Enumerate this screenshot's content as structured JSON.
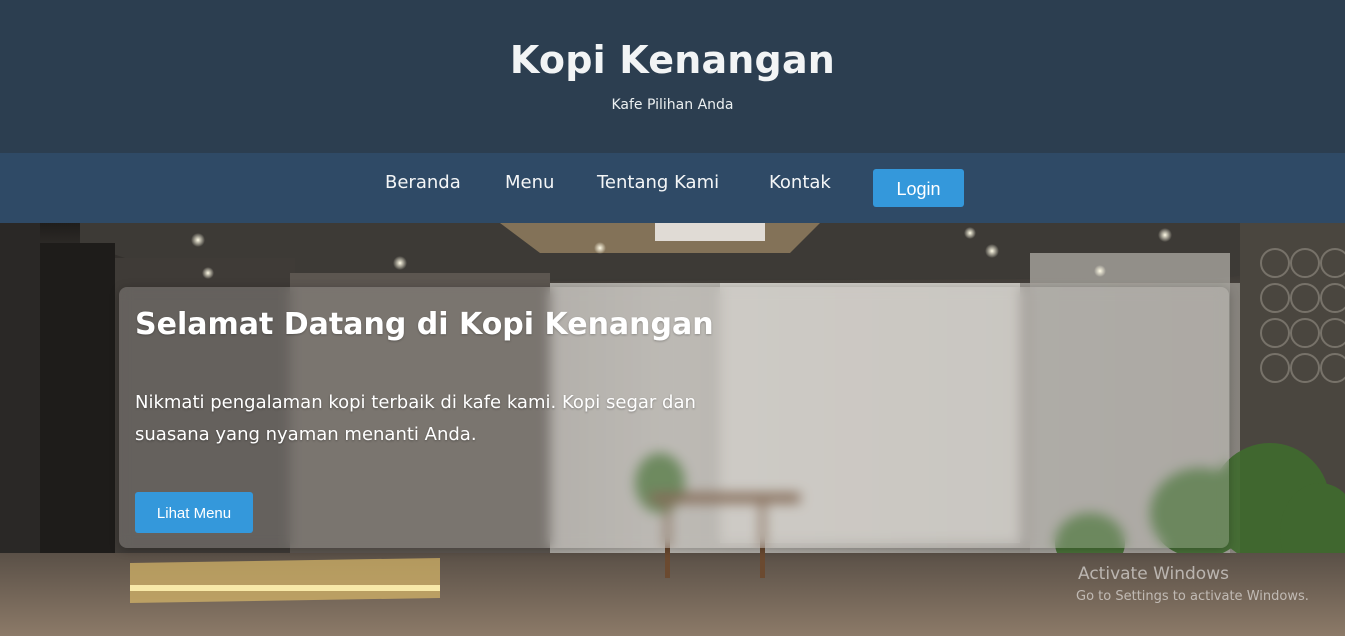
{
  "header": {
    "title": "Kopi Kenangan",
    "tagline": "Kafe Pilihan Anda"
  },
  "nav": {
    "items": [
      {
        "label": "Beranda"
      },
      {
        "label": "Menu"
      },
      {
        "label": "Tentang Kami"
      },
      {
        "label": "Kontak"
      }
    ],
    "login_label": "Login"
  },
  "hero": {
    "heading": "Selamat Datang di Kopi Kenangan",
    "text": "Nikmati pengalaman kopi terbaik di kafe kami. Kopi segar dan suasana yang nyaman menanti Anda.",
    "button_label": "Lihat Menu"
  },
  "watermark": {
    "title": "Activate Windows",
    "subtitle": "Go to Settings to activate Windows."
  },
  "colors": {
    "header_bg": "#2c3e50",
    "nav_bg": "#2f4a66",
    "accent": "#3498db",
    "text_light": "#ecf0f1"
  }
}
